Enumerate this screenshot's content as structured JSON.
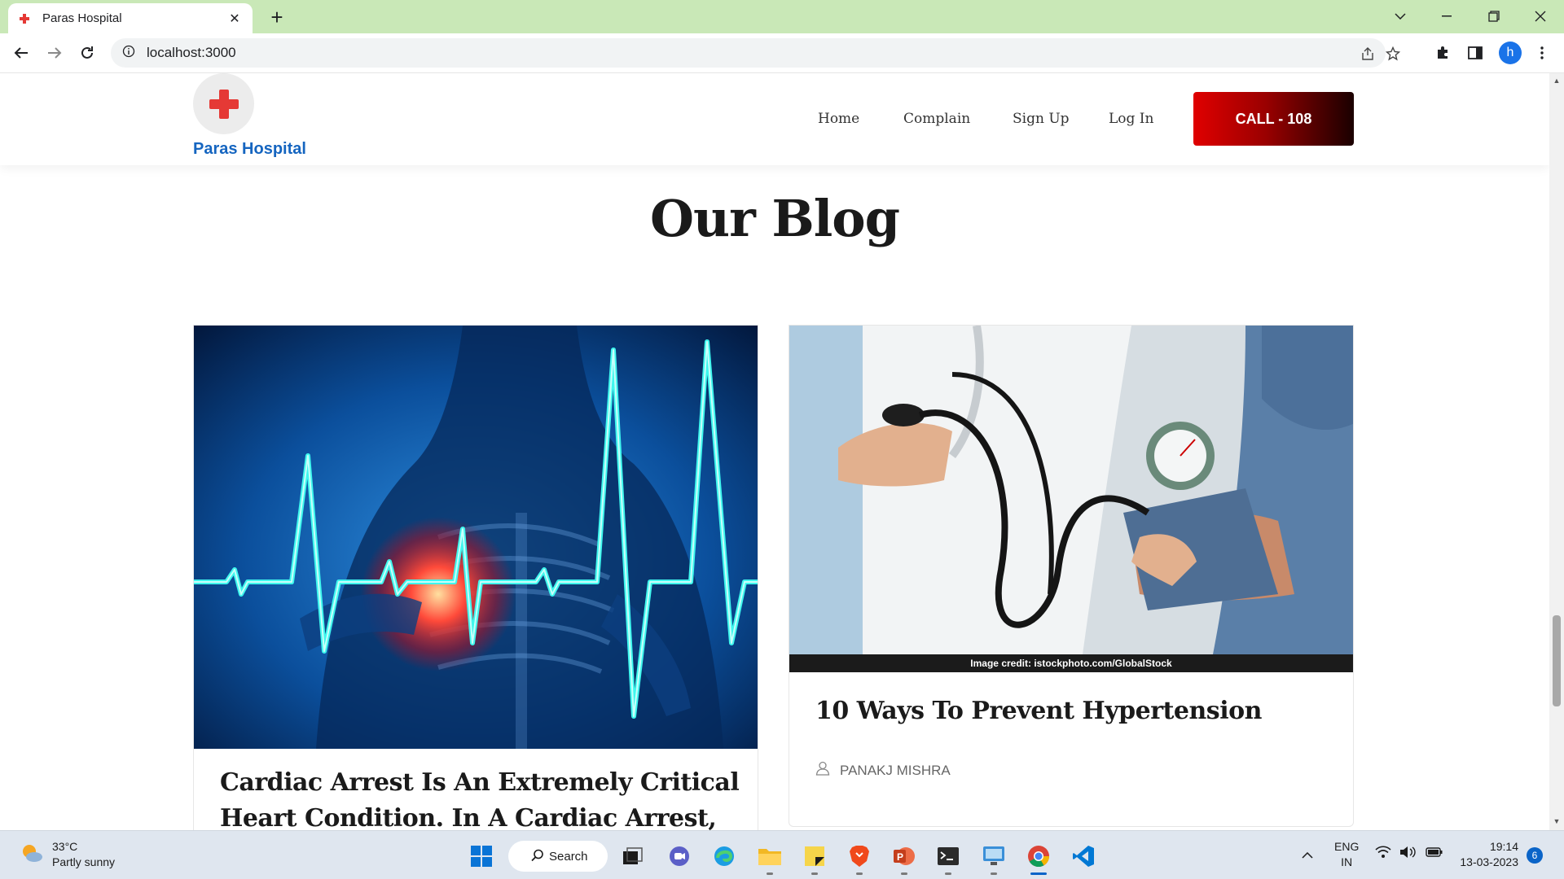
{
  "browser": {
    "tab_title": "Paras Hospital",
    "url": "localhost:3000",
    "profile_initial": "h"
  },
  "site": {
    "logo_name": "Paras Hospital",
    "nav": [
      "Home",
      "Complain",
      "Sign Up",
      "Log In"
    ],
    "call_button": "CALL - 108"
  },
  "blog": {
    "title": "Our Blog",
    "posts": [
      {
        "title": "Cardiac Arrest Is An Extremely Critical Heart Condition. In A Cardiac Arrest, The Heart",
        "image": "heart-ecg-illustration"
      },
      {
        "title": "10 Ways To Prevent Hypertension",
        "author": "PANAKJ MISHRA",
        "image_credit": "Image credit: istockphoto.com/GlobalStock",
        "image": "blood-pressure-measurement"
      }
    ]
  },
  "taskbar": {
    "weather_temp": "33°C",
    "weather_desc": "Partly sunny",
    "search_label": "Search",
    "lang_line1": "ENG",
    "lang_line2": "IN",
    "time": "19:14",
    "date": "13-03-2023",
    "notification_count": "6"
  },
  "colors": {
    "tabbar_bg": "#c9e8b7",
    "brand_blue": "#1565c0",
    "call_red": "#e00000",
    "logo_cross": "#e53935"
  }
}
